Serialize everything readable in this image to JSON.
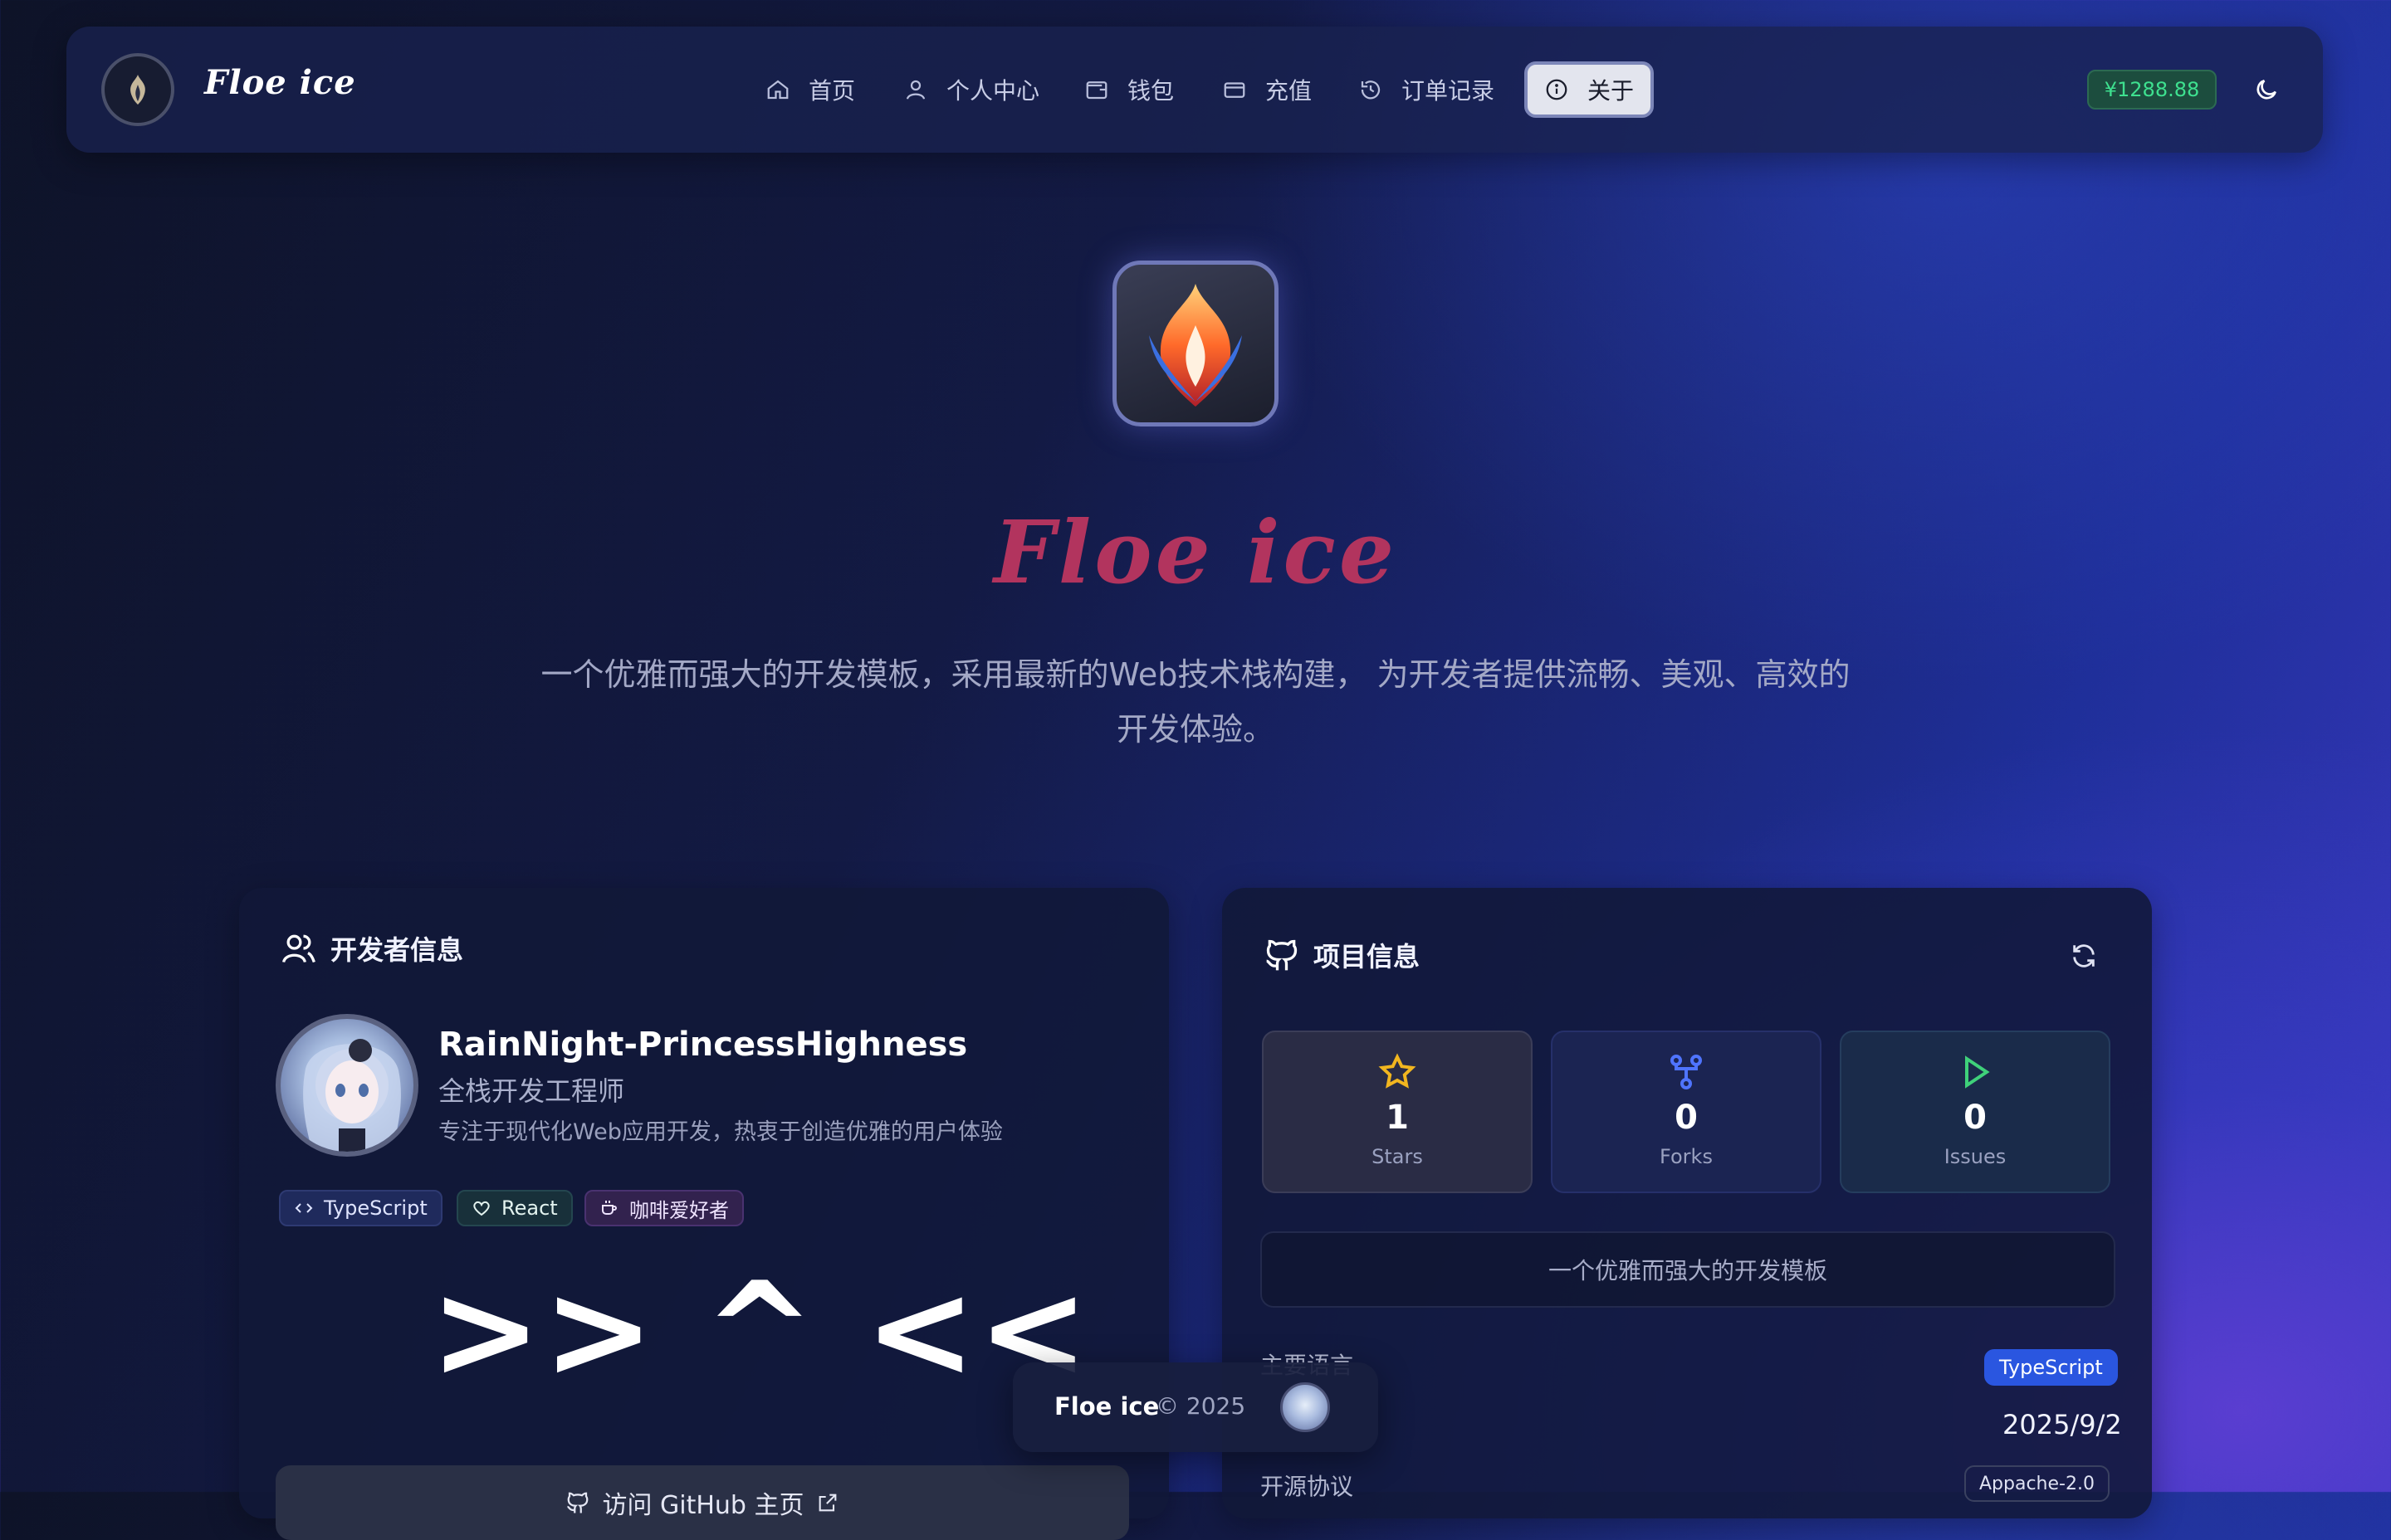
{
  "navbar": {
    "brand": "Floe ice",
    "items": [
      {
        "label": "首页",
        "icon": "home-icon"
      },
      {
        "label": "个人中心",
        "icon": "user-icon"
      },
      {
        "label": "钱包",
        "icon": "wallet-icon"
      },
      {
        "label": "充值",
        "icon": "credit-card-icon"
      },
      {
        "label": "订单记录",
        "icon": "history-icon"
      },
      {
        "label": "关于",
        "icon": "info-icon",
        "active": true
      }
    ],
    "balance": "¥1288.88",
    "theme_icon": "moon-icon"
  },
  "hero": {
    "title": "Floe ice",
    "description": "一个优雅而强大的开发模板，采用最新的Web技术栈构建， 为开发者提供流畅、美观、高效的开发体验。"
  },
  "developer": {
    "section_title": "开发者信息",
    "name": "RainNight-PrincessHighness",
    "role": "全栈开发工程师",
    "bio": "专注于现代化Web应用开发，热衷于创造优雅的用户体验",
    "tags": [
      {
        "label": "TypeScript",
        "icon": "code-icon"
      },
      {
        "label": "React",
        "icon": "heart-icon"
      },
      {
        "label": "咖啡爱好者",
        "icon": "coffee-icon"
      }
    ],
    "emote": ">> ^ <<",
    "github_button": "访问 GitHub 主页"
  },
  "project": {
    "section_title": "项目信息",
    "stats": [
      {
        "value": "1",
        "label": "Stars",
        "icon": "star-icon",
        "color": "#f2b61f"
      },
      {
        "value": "0",
        "label": "Forks",
        "icon": "fork-icon",
        "color": "#4f74ff"
      },
      {
        "value": "0",
        "label": "Issues",
        "icon": "play-icon",
        "color": "#3fd17a"
      }
    ],
    "description": "一个优雅而强大的开发模板",
    "language_label": "主要语言",
    "language": "TypeScript",
    "updated": "2025/9/2",
    "license_label": "开源协议",
    "license": "Appache-2.0"
  },
  "footer": {
    "brand": "Floe ice",
    "copyright": "© 2025"
  }
}
